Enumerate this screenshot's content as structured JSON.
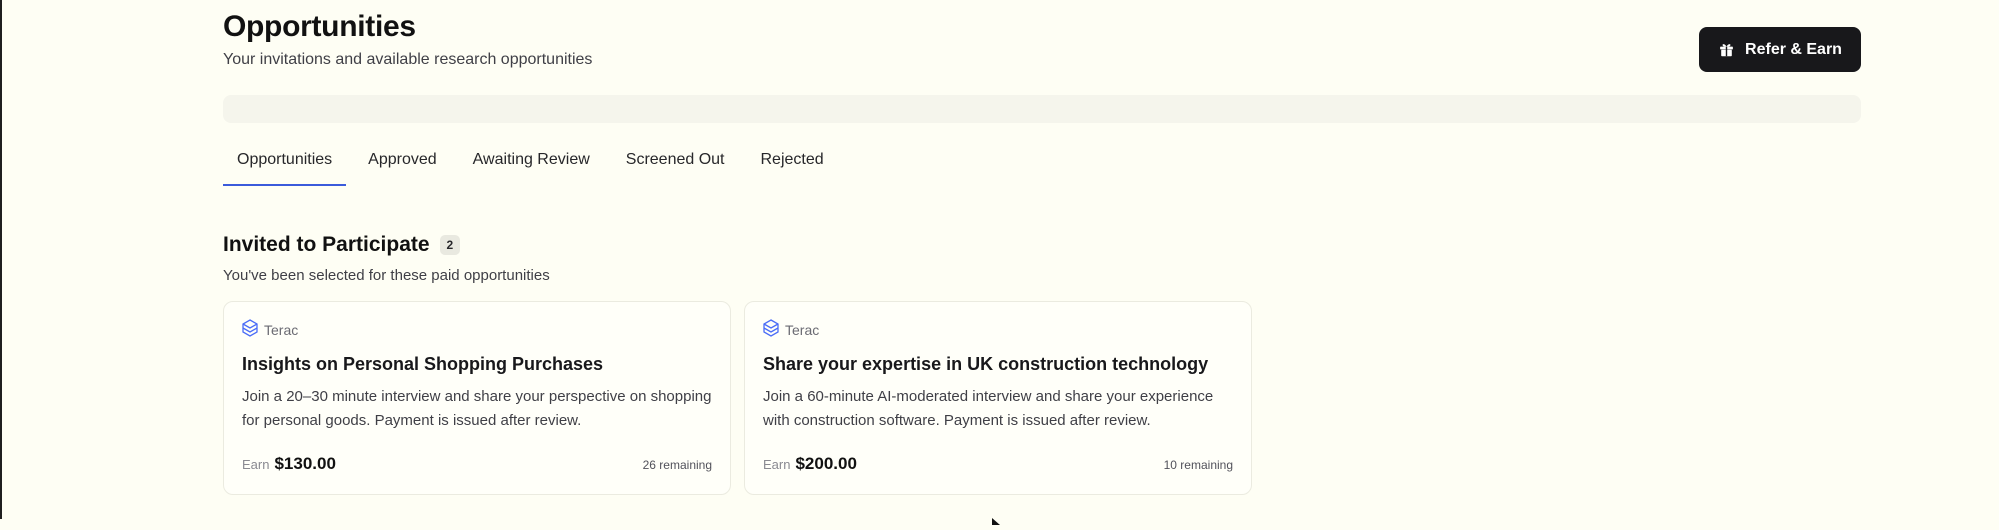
{
  "header": {
    "title": "Opportunities",
    "subtitle": "Your invitations and available research opportunities",
    "refer_button": {
      "label": "Refer & Earn",
      "icon": "gift-icon"
    }
  },
  "tabs": [
    {
      "label": "Opportunities",
      "active": true
    },
    {
      "label": "Approved",
      "active": false
    },
    {
      "label": "Awaiting Review",
      "active": false
    },
    {
      "label": "Screened Out",
      "active": false
    },
    {
      "label": "Rejected",
      "active": false
    }
  ],
  "invited_section": {
    "title": "Invited to Participate",
    "count": "2",
    "subtitle": "You've been selected for these paid opportunities"
  },
  "cards": [
    {
      "company": "Terac",
      "company_icon": "terac-logo-icon",
      "title": "Insights on Personal Shopping Purchases",
      "description": "Join a 20–30 minute interview and share your perspective on shopping for personal goods. Payment is issued after review.",
      "earn_label": "Earn",
      "earn_amount": "$130.00",
      "remaining": "26 remaining"
    },
    {
      "company": "Terac",
      "company_icon": "terac-logo-icon",
      "title": "Share your expertise in UK construction technology",
      "description": "Join a 60-minute AI-moderated interview and share your experience with construction software. Payment is issued after review.",
      "earn_label": "Earn",
      "earn_amount": "$200.00",
      "remaining": "10 remaining"
    }
  ],
  "colors": {
    "background": "#fefef4",
    "accent": "#3b5bdb",
    "button_bg": "#18181b",
    "logo": "#4a6cf7"
  }
}
